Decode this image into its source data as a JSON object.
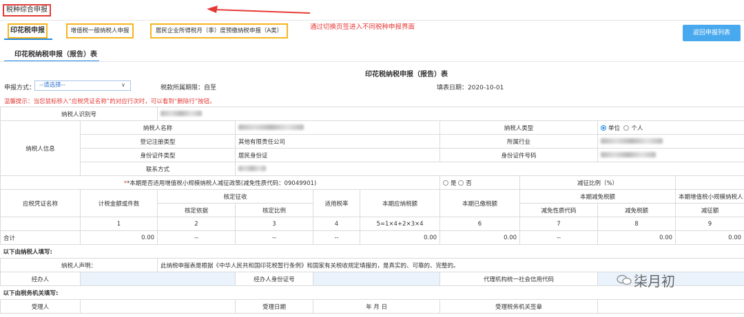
{
  "app_title": "税种综合申报",
  "tabs": [
    {
      "label": "印花税申报"
    },
    {
      "label": "增值税一般纳税人申报"
    },
    {
      "label": "居民企业所得税月（季）度预缴纳税申报（A类）"
    }
  ],
  "annotation": "通过切换页签进入不同税种申报界面",
  "back_button": "返回申报列表",
  "sub_tab": "印花税纳税申报（报告）表",
  "form_title": "印花税纳税申报（报告）表",
  "declare_method_label": "申报方式：",
  "declare_method_value": "--请选择--",
  "period_label": "税款所属期限：自至",
  "fill_date": "填表日期：2020-10-01",
  "tip": "温馨提示：当您鼠标移入“应税凭证名称”的对应行次时，可以看到“删除行”按钮。",
  "taxpayer_id_label": "纳税人识别号",
  "taxpayer_info_label": "纳税人信息",
  "taxpayer_name_label": "纳税人名称",
  "taxpayer_type_label": "纳税人类型",
  "taxpayer_type_opt1": "单位",
  "taxpayer_type_opt2": "个人",
  "reg_type_label": "登记注册类型",
  "reg_type_value": "其他有限责任公司",
  "industry_label": "所属行业",
  "id_type_label": "身份证件类型",
  "id_type_value": "居民身份证",
  "id_number_label": "身份证件号码",
  "contact_label": "联系方式",
  "small_policy_label": "*本期是否适用增值税小规模纳税人减征政策(减免性质代码：09049901)",
  "small_policy_yes": "是",
  "small_policy_no": "否",
  "reduction_ratio_label": "减征比例（%）",
  "columns": {
    "voucher_name": "应税凭证名称",
    "taxable_amount": "计税金额或件数",
    "verified": "核定征收",
    "basis": "核定依据",
    "ratio": "核定比例",
    "rate": "适用税率",
    "payable": "本期应纳税额",
    "paid": "本期已缴税额",
    "relief": "本期减免税额",
    "relief_code": "减免性质代码",
    "relief_amount": "减免税额",
    "small_relief": "本期增值税小规模纳税人",
    "small_amount": "减征额"
  },
  "col_numbers": [
    "1",
    "2",
    "3",
    "4",
    "5=1×4+2×3×4",
    "6",
    "7",
    "8",
    "9"
  ],
  "total_row": {
    "label": "合计",
    "v1": "0.00",
    "v2": "--",
    "v3": "--",
    "v4": "--",
    "v5": "0.00",
    "v6": "0.00",
    "v7": "--",
    "v8": "0.00",
    "v9": "0.00"
  },
  "section_taxpayer": "以下由纳税人填写:",
  "declaration_label": "纳税人声明：",
  "declaration_text": "此纳税申报表是根据《中华人民共和国印花税暂行条例》和国家有关税收规定填报的，是真实的、可靠的、完整的。",
  "handler_label": "经办人",
  "handler_id_label": "经办人身份证号",
  "agency_code_label": "代理机构统一社会信用代码",
  "section_tax_office": "以下由税务机关填写:",
  "accept_label": "受理人",
  "accept_date_label": "受理日期",
  "accept_date_fmt": "年   月   日",
  "accept_office_label": "受理税务机关签章",
  "watermark": "柒月初",
  "colors": {
    "accent": "#1e88e5",
    "annotation": "#e53935",
    "highlight": "#f5b51d",
    "button": "#49a9ee"
  }
}
